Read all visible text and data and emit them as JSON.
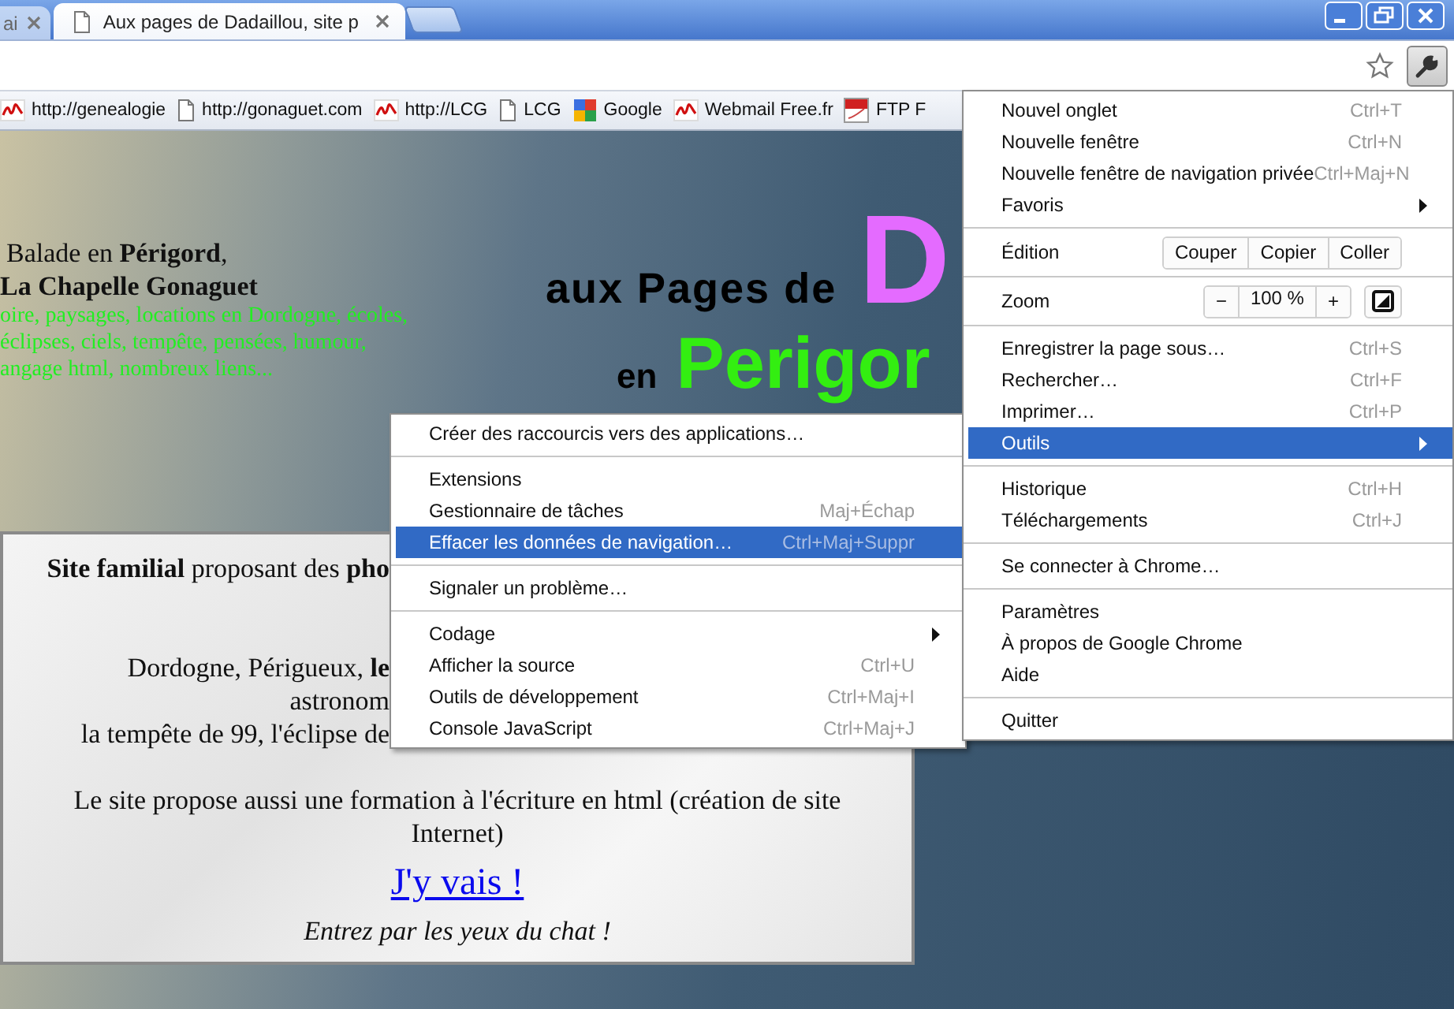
{
  "tabs": [
    {
      "title": "ai",
      "selected": false
    },
    {
      "title": "Aux pages de Dadaillou, site p",
      "selected": true
    }
  ],
  "bookmarks": [
    {
      "kind": "free",
      "label": "http://genealogie"
    },
    {
      "kind": "page",
      "label": "http://gonaguet.com"
    },
    {
      "kind": "free",
      "label": "http://LCG"
    },
    {
      "kind": "page",
      "label": "LCG"
    },
    {
      "kind": "google",
      "label": "Google"
    },
    {
      "kind": "free",
      "label": "Webmail Free.fr"
    },
    {
      "kind": "ftp",
      "label": "FTP F"
    }
  ],
  "page": {
    "intro_title": "Balade en **Périgord**,",
    "intro_subtitle": "La Chapelle Gonaguet",
    "intro_keywords": [
      "oire, paysages, locations en Dordogne, écoles,",
      "éclipses, ciels, tempête, pensées, humour,",
      "angage html, nombreux liens..."
    ],
    "logo": {
      "line1": "aux Pages de",
      "initial": "D",
      "line2_prefix": "en",
      "line2": "Perigor"
    },
    "panel": {
      "clipped_lines": [
        "**Site familial** proposant des **pho**",
        "Dordogne, Périgueux, **le**",
        "astronom",
        "la tempête de 99, l'éclipse de"
      ],
      "formation": "Le site propose aussi une formation à l'écriture en html (création de site Internet)",
      "link": "J'y vais !",
      "tagline": "Entrez par les yeux du chat !"
    }
  },
  "menu": {
    "items": [
      {
        "kind": "item",
        "label": "Nouvel onglet",
        "shortcut": "Ctrl+T",
        "submenu": false,
        "selected": false
      },
      {
        "kind": "item",
        "label": "Nouvelle fenêtre",
        "shortcut": "Ctrl+N",
        "submenu": false,
        "selected": false
      },
      {
        "kind": "item",
        "label": "Nouvelle fenêtre de navigation privée",
        "shortcut": "Ctrl+Maj+N",
        "submenu": false,
        "selected": false
      },
      {
        "kind": "item",
        "label": "Favoris",
        "submenu": true,
        "selected": false
      },
      {
        "kind": "separator"
      },
      {
        "kind": "edit",
        "label": "Édition",
        "buttons": [
          "Couper",
          "Copier",
          "Coller"
        ]
      },
      {
        "kind": "separator"
      },
      {
        "kind": "zoom",
        "label": "Zoom",
        "minus": "−",
        "value": "100 %",
        "plus": "+"
      },
      {
        "kind": "separator"
      },
      {
        "kind": "item",
        "label": "Enregistrer la page sous…",
        "shortcut": "Ctrl+S",
        "submenu": false,
        "selected": false
      },
      {
        "kind": "item",
        "label": "Rechercher…",
        "shortcut": "Ctrl+F",
        "submenu": false,
        "selected": false
      },
      {
        "kind": "item",
        "label": "Imprimer…",
        "shortcut": "Ctrl+P",
        "submenu": false,
        "selected": false
      },
      {
        "kind": "item",
        "label": "Outils",
        "submenu": true,
        "selected": true
      },
      {
        "kind": "separator"
      },
      {
        "kind": "item",
        "label": "Historique",
        "shortcut": "Ctrl+H",
        "submenu": false,
        "selected": false
      },
      {
        "kind": "item",
        "label": "Téléchargements",
        "shortcut": "Ctrl+J",
        "submenu": false,
        "selected": false
      },
      {
        "kind": "separator"
      },
      {
        "kind": "item",
        "label": "Se connecter à Chrome…",
        "submenu": false,
        "selected": false
      },
      {
        "kind": "separator"
      },
      {
        "kind": "item",
        "label": "Paramètres",
        "submenu": false,
        "selected": false
      },
      {
        "kind": "item",
        "label": "À propos de Google Chrome",
        "submenu": false,
        "selected": false
      },
      {
        "kind": "item",
        "label": "Aide",
        "submenu": false,
        "selected": false
      },
      {
        "kind": "separator"
      },
      {
        "kind": "item",
        "label": "Quitter",
        "submenu": false,
        "selected": false
      }
    ]
  },
  "submenu": {
    "items": [
      {
        "kind": "item",
        "label": "Créer des raccourcis vers des applications…",
        "submenu": false,
        "selected": false
      },
      {
        "kind": "separator"
      },
      {
        "kind": "item",
        "label": "Extensions",
        "submenu": false,
        "selected": false
      },
      {
        "kind": "item",
        "label": "Gestionnaire de tâches",
        "shortcut": "Maj+Échap",
        "submenu": false,
        "selected": false
      },
      {
        "kind": "item",
        "label": "Effacer les données de navigation…",
        "shortcut": "Ctrl+Maj+Suppr",
        "submenu": false,
        "selected": true
      },
      {
        "kind": "separator"
      },
      {
        "kind": "item",
        "label": "Signaler un problème…",
        "submenu": false,
        "selected": false
      },
      {
        "kind": "separator"
      },
      {
        "kind": "item",
        "label": "Codage",
        "submenu": true,
        "selected": false
      },
      {
        "kind": "item",
        "label": "Afficher la source",
        "shortcut": "Ctrl+U",
        "submenu": false,
        "selected": false
      },
      {
        "kind": "item",
        "label": "Outils de développement",
        "shortcut": "Ctrl+Maj+I",
        "submenu": false,
        "selected": false
      },
      {
        "kind": "item",
        "label": "Console JavaScript",
        "shortcut": "Ctrl+Maj+J",
        "submenu": false,
        "selected": false
      }
    ]
  }
}
